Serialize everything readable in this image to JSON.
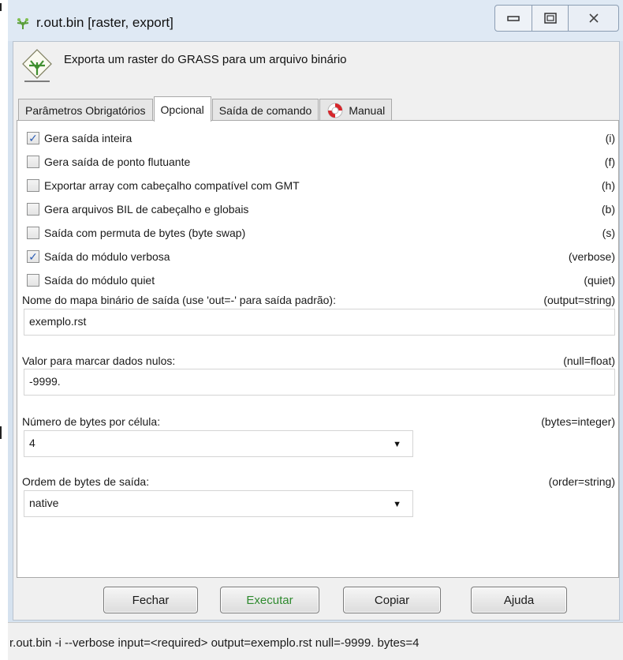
{
  "window": {
    "title": "r.out.bin [raster, export]",
    "buttons": [
      "minimize",
      "maximize",
      "close"
    ]
  },
  "header": {
    "description": "Exporta um raster do GRASS para um arquivo binário"
  },
  "tabs": [
    {
      "label": "Parâmetros Obrigatórios",
      "active": false
    },
    {
      "label": "Opcional",
      "active": true
    },
    {
      "label": "Saída de comando",
      "active": false
    },
    {
      "label": "Manual",
      "active": false,
      "icon": "lifebuoy-icon"
    }
  ],
  "flags": [
    {
      "label": "Gera saída inteira",
      "flag": "(i)",
      "checked": true
    },
    {
      "label": "Gera saída de ponto flutuante",
      "flag": "(f)",
      "checked": false
    },
    {
      "label": "Exportar array com cabeçalho compatível com GMT",
      "flag": "(h)",
      "checked": false
    },
    {
      "label": "Gera arquivos BIL de cabeçalho e globais",
      "flag": "(b)",
      "checked": false
    },
    {
      "label": "Saída com permuta de bytes (byte swap)",
      "flag": "(s)",
      "checked": false
    },
    {
      "label": "Saída do módulo verbosa",
      "flag": "(verbose)",
      "checked": true
    },
    {
      "label": "Saída do módulo quiet",
      "flag": "(quiet)",
      "checked": false
    }
  ],
  "params": {
    "output": {
      "label": "Nome do mapa binário de saída (use 'out=-' para saída padrão):",
      "key": "(output=string)",
      "value": "exemplo.rst"
    },
    "null": {
      "label": "Valor para marcar dados nulos:",
      "key": "(null=float)",
      "value": "-9999."
    },
    "bytes": {
      "label": "Número de bytes por célula:",
      "key": "(bytes=integer)",
      "value": "4"
    },
    "order": {
      "label": "Ordem de bytes de saída:",
      "key": "(order=string)",
      "value": "native"
    }
  },
  "buttons": {
    "close": "Fechar",
    "run": "Executar",
    "copy": "Copiar",
    "help": "Ajuda"
  },
  "status": "r.out.bin -i --verbose input=<required> output=exemplo.rst null=-9999. bytes=4",
  "colors": {
    "frame": "#d6e2ef",
    "run_text": "#2f8a2f",
    "check": "#2a5bb3"
  }
}
